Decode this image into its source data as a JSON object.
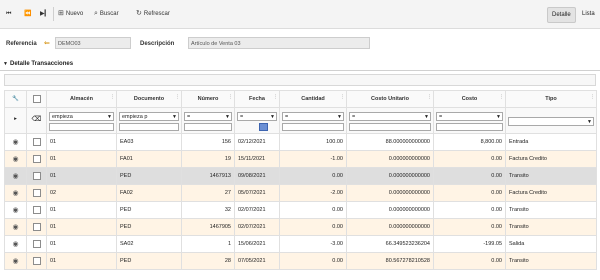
{
  "toolbar": {
    "first_icon": "⏮",
    "prev_icon": "⏪",
    "nuevo": "Nuevo",
    "buscar": "Buscar",
    "refrescar": "Refrescar",
    "detalle": "Detalle",
    "lista": "Lista"
  },
  "header": {
    "referencia_label": "Referencia",
    "referencia_value": "DEMO03",
    "descripcion_label": "Descripción",
    "descripcion_value": "Artículo de Venta 03"
  },
  "section": {
    "title": "Detalle Transacciones"
  },
  "grid": {
    "columns": [
      "Almacén",
      "Documento",
      "Número",
      "Fecha",
      "Cantidad",
      "Costo Unitario",
      "Costo",
      "Tipo"
    ],
    "filters": {
      "almacen": "empieza",
      "documento": "empieza p",
      "numero": "=",
      "fecha": "=",
      "cantidad": "=",
      "costo_unitario": "=",
      "costo": "=",
      "tipo": ""
    },
    "rows": [
      {
        "almacen": "01",
        "documento": "EA03",
        "numero": "156",
        "fecha": "02/12/2021",
        "cantidad": "100.00",
        "costo_unitario": "88.000000000000",
        "costo": "8,800.00",
        "tipo": "Entrada",
        "style": "odd"
      },
      {
        "almacen": "01",
        "documento": "FA01",
        "numero": "19",
        "fecha": "15/11/2021",
        "cantidad": "-1.00",
        "costo_unitario": "0.000000000000",
        "costo": "0.00",
        "tipo": "Factura Credito",
        "style": "even"
      },
      {
        "almacen": "01",
        "documento": "PED",
        "numero": "1467913",
        "fecha": "09/08/2021",
        "cantidad": "0.00",
        "costo_unitario": "0.000000000000",
        "costo": "0.00",
        "tipo": "Transito",
        "style": "sel"
      },
      {
        "almacen": "02",
        "documento": "FA02",
        "numero": "27",
        "fecha": "05/07/2021",
        "cantidad": "-2.00",
        "costo_unitario": "0.000000000000",
        "costo": "0.00",
        "tipo": "Factura Credito",
        "style": "even"
      },
      {
        "almacen": "01",
        "documento": "PED",
        "numero": "32",
        "fecha": "02/07/2021",
        "cantidad": "0.00",
        "costo_unitario": "0.000000000000",
        "costo": "0.00",
        "tipo": "Transito",
        "style": "odd"
      },
      {
        "almacen": "01",
        "documento": "PED",
        "numero": "1467905",
        "fecha": "02/07/2021",
        "cantidad": "0.00",
        "costo_unitario": "0.000000000000",
        "costo": "0.00",
        "tipo": "Transito",
        "style": "even"
      },
      {
        "almacen": "01",
        "documento": "SA02",
        "numero": "1",
        "fecha": "15/06/2021",
        "cantidad": "-3.00",
        "costo_unitario": "66.349523236204",
        "costo": "-199.05",
        "tipo": "Salida",
        "style": "odd"
      },
      {
        "almacen": "01",
        "documento": "PED",
        "numero": "28",
        "fecha": "07/05/2021",
        "cantidad": "0.00",
        "costo_unitario": "80.567278210528",
        "costo": "0.00",
        "tipo": "Transito",
        "style": "even"
      }
    ]
  }
}
